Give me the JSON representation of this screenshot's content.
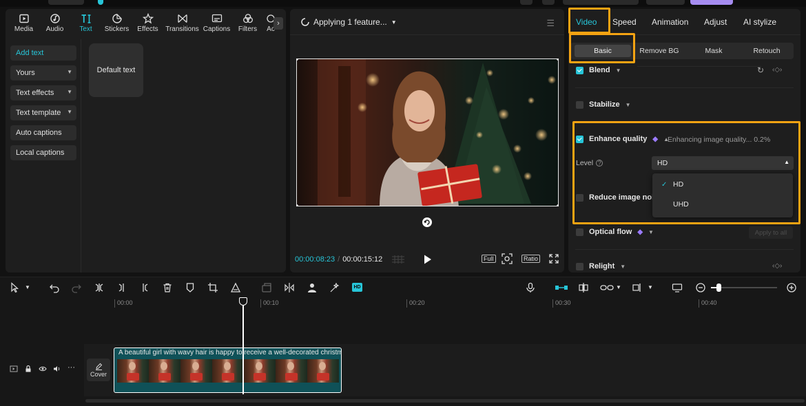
{
  "media_tabs": [
    {
      "label": "Media",
      "icon": "media-icon"
    },
    {
      "label": "Audio",
      "icon": "audio-icon"
    },
    {
      "label": "Text",
      "icon": "text-icon",
      "active": true
    },
    {
      "label": "Stickers",
      "icon": "stickers-icon"
    },
    {
      "label": "Effects",
      "icon": "effects-icon"
    },
    {
      "label": "Transitions",
      "icon": "transitions-icon"
    },
    {
      "label": "Captions",
      "icon": "captions-icon"
    },
    {
      "label": "Filters",
      "icon": "filters-icon"
    },
    {
      "label": "Ac",
      "icon": "adjust-icon"
    }
  ],
  "text_sidebar": {
    "add_text": "Add text",
    "yours": "Yours",
    "text_effects": "Text effects",
    "text_template": "Text template",
    "auto_captions": "Auto captions",
    "local_captions": "Local captions"
  },
  "default_text_card": "Default text",
  "player": {
    "status": "Applying 1 feature...",
    "current_time": "00:00:08:23",
    "total_time": "00:00:15:12",
    "full_label": "Full",
    "ratio_label": "Ratio"
  },
  "right_tabs": [
    "Video",
    "Speed",
    "Animation",
    "Adjust",
    "AI stylize"
  ],
  "active_right_tab": "Video",
  "sub_tabs": [
    "Basic",
    "Remove BG",
    "Mask",
    "Retouch"
  ],
  "active_sub_tab": "Basic",
  "properties": {
    "blend": {
      "label": "Blend",
      "checked": true
    },
    "stabilize": {
      "label": "Stabilize",
      "checked": false
    },
    "enhance_quality": {
      "label": "Enhance quality",
      "checked": true,
      "status": "Enhancing image quality... 0.2%",
      "level_label": "Level",
      "level_value": "HD",
      "level_options": [
        "HD",
        "UHD"
      ]
    },
    "reduce_noise": {
      "label": "Reduce image noise",
      "checked": false
    },
    "optical_flow": {
      "label": "Optical flow",
      "checked": false
    },
    "apply_to_all": "Apply to all",
    "relight": {
      "label": "Relight",
      "checked": false
    }
  },
  "timeline": {
    "ruler_ticks": [
      "00:00",
      "00:10",
      "00:20",
      "00:30",
      "00:40"
    ],
    "clip_title": "A beautiful girl with wavy hair is happy to receive a well-decorated christmas",
    "cover_label": "Cover",
    "hd_badge": "HD"
  },
  "colors": {
    "accent": "#27c5d8",
    "highlight": "#f5a312",
    "premium_gem": "#9b7bff"
  }
}
